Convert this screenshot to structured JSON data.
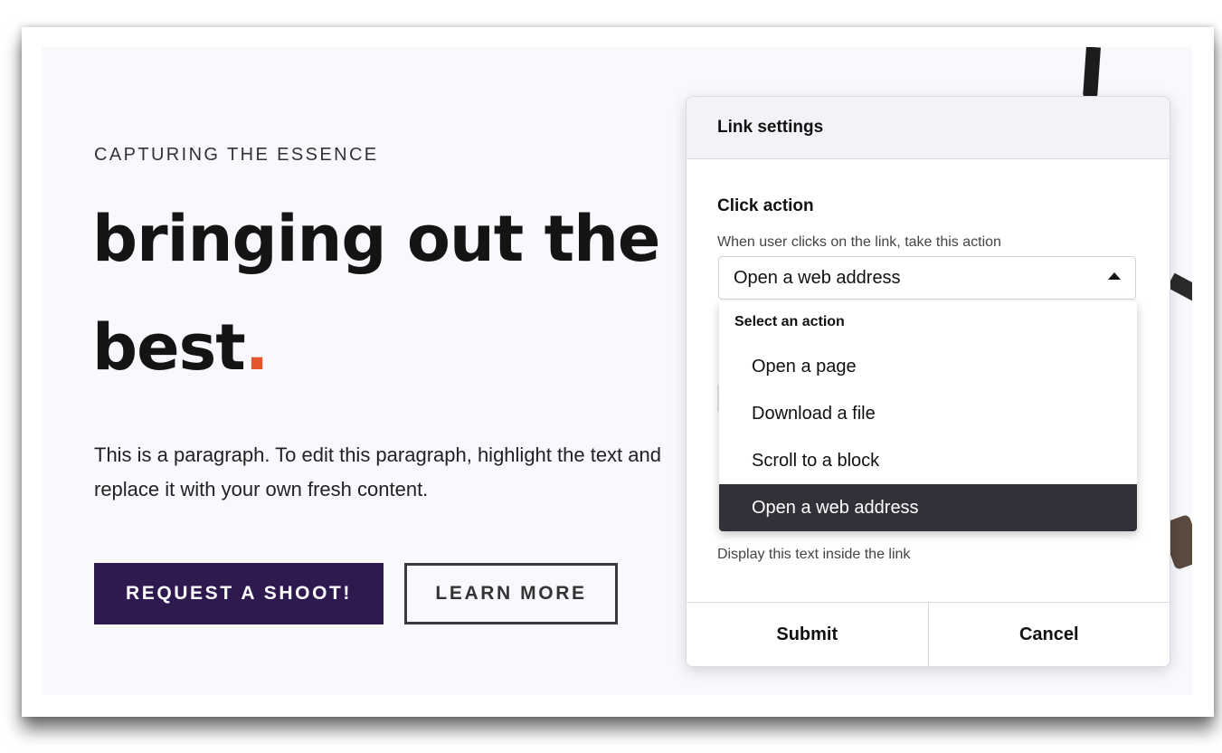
{
  "hero": {
    "eyebrow": "CAPTURING THE ESSENCE",
    "headline_main": "bringing out the best",
    "headline_dot": ".",
    "paragraph": "This is a paragraph. To edit this paragraph, highlight the text and replace it with your own fresh content.",
    "primary_button": "REQUEST A SHOOT!",
    "secondary_button": "LEARN MORE"
  },
  "modal": {
    "title": "Link settings",
    "click_action_label": "Click action",
    "click_action_help": "When user clicks on the link, take this action",
    "select_value": "Open a web address",
    "dropdown_header": "Select an action",
    "options": [
      {
        "label": "Open a page",
        "selected": false
      },
      {
        "label": "Download a file",
        "selected": false
      },
      {
        "label": "Scroll to a block",
        "selected": false
      },
      {
        "label": "Open a web address",
        "selected": true
      }
    ],
    "text_help": "Display this text inside the link",
    "submit_label": "Submit",
    "cancel_label": "Cancel"
  },
  "colors": {
    "primary_button_bg": "#2e1a4f",
    "accent_dot": "#e4572e",
    "selected_option_bg": "#32313a",
    "canvas_bg": "#f8f8fd"
  },
  "icons": {
    "select_caret": "caret-up-icon"
  }
}
